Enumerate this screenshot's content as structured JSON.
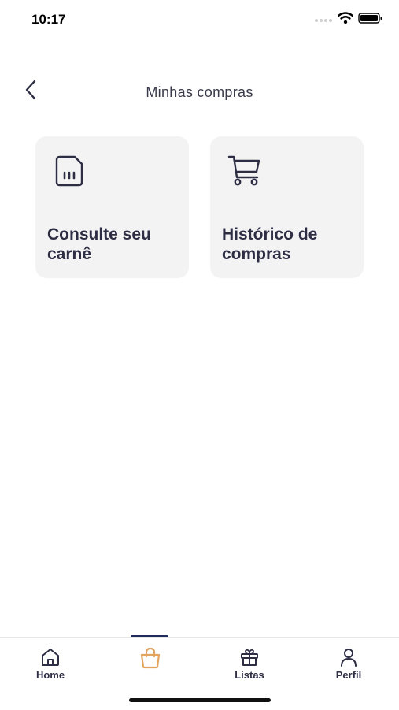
{
  "status_bar": {
    "time": "10:17"
  },
  "header": {
    "title": "Minhas compras"
  },
  "cards": [
    {
      "label": "Consulte seu carnê",
      "icon": "document-barcode-icon"
    },
    {
      "label": "Histórico de compras",
      "icon": "shopping-cart-icon"
    }
  ],
  "tab_bar": {
    "items": [
      {
        "label": "Home",
        "icon": "home-icon"
      },
      {
        "label": "",
        "icon": "shopping-bag-icon",
        "active": true
      },
      {
        "label": "Listas",
        "icon": "gift-icon"
      },
      {
        "label": "Perfil",
        "icon": "user-icon"
      }
    ]
  },
  "colors": {
    "accent": "#e2a45e",
    "indicator": "#1f2b5a",
    "card_background": "#f3f3f3",
    "text": "#2d2d44"
  }
}
